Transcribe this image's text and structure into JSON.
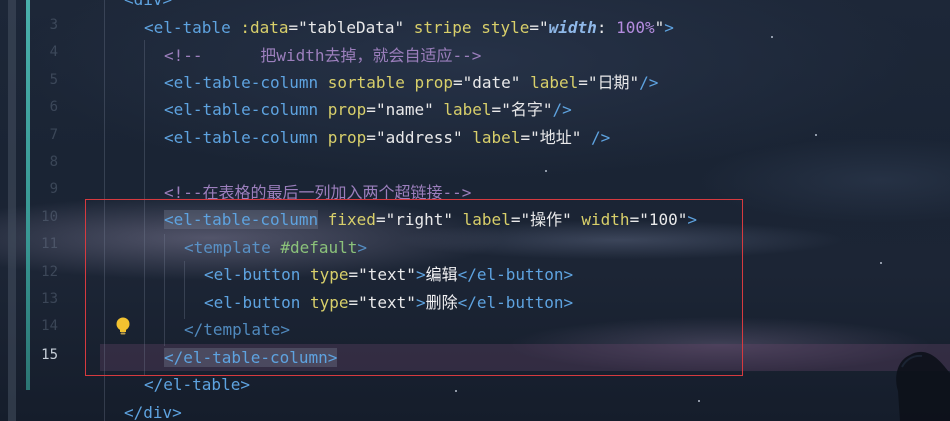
{
  "editor": {
    "current_line_number": "15",
    "line_numbers": [
      "3",
      "4",
      "5",
      "6",
      "7",
      "8",
      "9",
      "10",
      "11",
      "12",
      "13",
      "14",
      "15"
    ],
    "lines": {
      "l0_tag": "div",
      "l1_open": "<el-table",
      "l1_attr1": ":data",
      "l1_val1": "\"tableData\"",
      "l1_attr2": "stripe",
      "l1_attr3": "style",
      "l1_val3_a": "\"",
      "l1_val3_kw": "width",
      "l1_val3_b": ": ",
      "l1_val3_num": "100%",
      "l1_val3_c": "\"",
      "l1_close": ">",
      "l2_comment": "<!--      把width去掉，就会自适应-->",
      "l3_open": "<el-table-column",
      "l3_attr1": "sortable",
      "l3_attr2": "prop",
      "l3_val2": "\"date\"",
      "l3_attr3": "label",
      "l3_val3": "\"日期\"",
      "l3_close": "/>",
      "l4_open": "<el-table-column",
      "l4_attr1": "prop",
      "l4_val1": "\"name\"",
      "l4_attr2": "label",
      "l4_val2": "\"名字\"",
      "l4_close": "/>",
      "l5_open": "<el-table-column",
      "l5_attr1": "prop",
      "l5_val1": "\"address\"",
      "l5_attr2": "label",
      "l5_val2": "\"地址\"",
      "l5_close": "/>",
      "l7_comment": "<!--在表格的最后一列加入两个超链接-->",
      "l8_open": "<el-table-column",
      "l8_attr1": "fixed",
      "l8_val1": "\"right\"",
      "l8_attr2": "label",
      "l8_val2": "\"操作\"",
      "l8_attr3": "width",
      "l8_val3": "\"100\"",
      "l8_close": ">",
      "l9_open": "<template",
      "l9_attr": "#default",
      "l9_close": ">",
      "l10_open": "<el-button",
      "l10_attr": "type",
      "l10_val": "\"text\"",
      "l10_gt": ">",
      "l10_text": "编辑",
      "l10_end": "</el-button>",
      "l11_open": "<el-button",
      "l11_attr": "type",
      "l11_val": "\"text\"",
      "l11_gt": ">",
      "l11_text": "删除",
      "l11_end": "</el-button>",
      "l12_end": "</template>",
      "l13_end": "</el-table-column>",
      "l14_end": "</el-table>",
      "l15_end": "</div>"
    }
  },
  "colors": {
    "tag": "#5ea3e0",
    "attribute": "#d8cf6a",
    "string": "#e9e9ea",
    "comment": "#9c7fbd",
    "selection_border": "#d63a3f",
    "gutter_accent": "#4fbfb8"
  },
  "icons": {
    "bulb": "lightbulb-icon"
  }
}
